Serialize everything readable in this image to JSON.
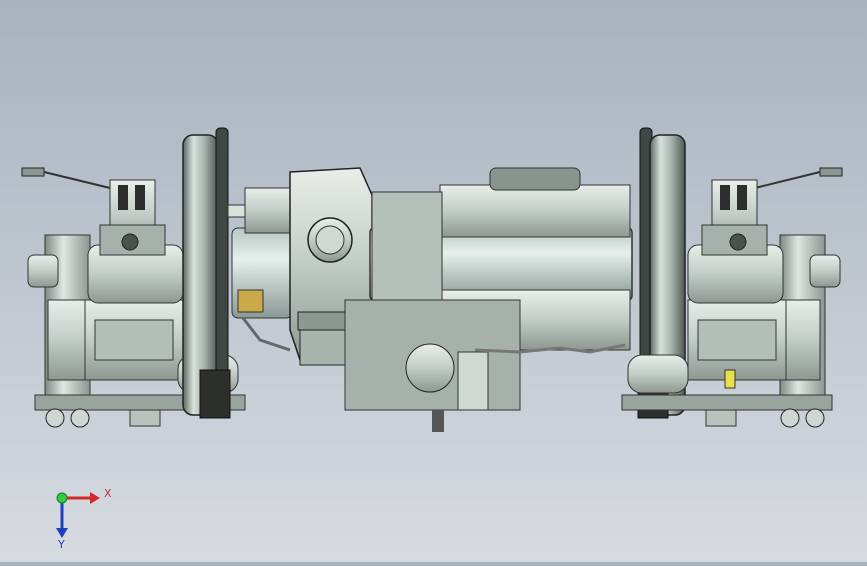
{
  "viewport": {
    "background_top": "#a9b2bf",
    "background_bottom": "#d6dbe1",
    "model_color": "#c9d3cf"
  },
  "triad": {
    "x_label": "X",
    "y_label": "Y",
    "x_color": "#d62828",
    "y_color": "#2ecc40",
    "z_color": "#1f3fbf"
  }
}
